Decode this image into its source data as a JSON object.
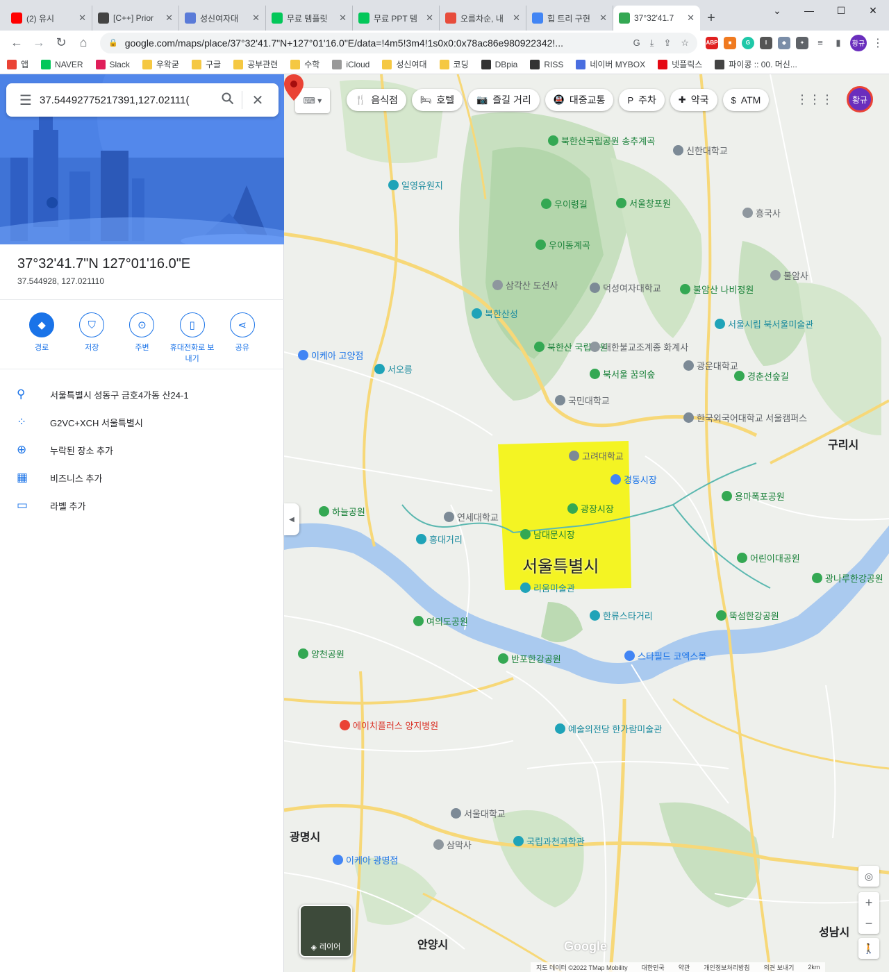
{
  "browser": {
    "tabs": [
      {
        "title": "(2) 유시",
        "color": "#ff0000",
        "icon": "youtube-icon"
      },
      {
        "title": "[C++] Prior",
        "color": "#444444",
        "icon": "tree-icon"
      },
      {
        "title": "성신여자대",
        "color": "#5a7bd8",
        "icon": "globe-icon"
      },
      {
        "title": "무료 템플릿",
        "color": "#03c75a",
        "icon": "naver-icon"
      },
      {
        "title": "무료 PPT 템",
        "color": "#03c75a",
        "icon": "blog-icon"
      },
      {
        "title": "오름차순, 내",
        "color": "#e74c3c",
        "icon": "z-icon"
      },
      {
        "title": "힙 트리 구현",
        "color": "#4285f4",
        "icon": "google-icon"
      },
      {
        "title": "37°32'41.7",
        "color": "#34a853",
        "icon": "maps-pin-icon"
      }
    ],
    "url": "google.com/maps/place/37°32'41.7\"N+127°01'16.0\"E/data=!4m5!3m4!1s0x0:0x78ac86e980922342!...",
    "bookmarks": [
      "앱",
      "NAVER",
      "Slack",
      "우왁굳",
      "구글",
      "공부관련",
      "수학",
      "iCloud",
      "성신여대",
      "코딩",
      "DBpia",
      "RISS",
      "네이버 MYBOX",
      "넷플릭스",
      "파이콩 :: 00. 머신..."
    ],
    "profile_initials": "황규"
  },
  "panel": {
    "search_value": "37.54492775217391,127.02111(",
    "title": "37°32'41.7\"N 127°01'16.0\"E",
    "decimal": "37.544928, 127.021110",
    "actions": [
      {
        "label": "경로",
        "icon": "directions-icon"
      },
      {
        "label": "저장",
        "icon": "bookmark-icon"
      },
      {
        "label": "주변",
        "icon": "nearby-icon"
      },
      {
        "label": "휴대전화로 보내기",
        "icon": "phone-icon"
      },
      {
        "label": "공유",
        "icon": "share-icon"
      }
    ],
    "info": [
      {
        "text": "서울특별시 성동구 금호4가동 산24-1",
        "icon": "location-pin-icon"
      },
      {
        "text": "G2VC+XCH 서울특별시",
        "icon": "plus-code-icon"
      },
      {
        "text": "누락된 장소 추가",
        "icon": "add-place-icon"
      },
      {
        "text": "비즈니스 추가",
        "icon": "add-business-icon"
      },
      {
        "text": "라벨 추가",
        "icon": "label-icon"
      }
    ]
  },
  "map": {
    "chips": [
      {
        "label": "음식점",
        "icon": "restaurant-icon"
      },
      {
        "label": "호텔",
        "icon": "hotel-icon"
      },
      {
        "label": "즐길 거리",
        "icon": "camera-icon"
      },
      {
        "label": "대중교통",
        "icon": "transit-icon"
      },
      {
        "label": "주차",
        "icon": "parking-icon"
      },
      {
        "label": "약국",
        "icon": "pharmacy-icon"
      },
      {
        "label": "ATM",
        "icon": "atm-icon"
      }
    ],
    "highlight_label": "서울특별시",
    "cities": [
      "구리시",
      "광명시",
      "안양시",
      "성남시"
    ],
    "pois": {
      "park": [
        "북한산국립공원 송추계곡",
        "우이령길",
        "서울창포원",
        "우이동계곡",
        "불암산 나비정원",
        "북한산 국립공원",
        "북서울 꿈의숲",
        "경춘선숲길",
        "용마폭포공원",
        "하늘공원",
        "여의도공원",
        "뚝섬한강공원",
        "광나루한강공원",
        "반포한강공원",
        "양천공원",
        "어린이대공원",
        "남대문시장",
        "광장시장"
      ],
      "attraction": [
        "일영유원지",
        "북한산성",
        "서오릉",
        "홍대거리",
        "한류스타거리",
        "서울시립 북서울미술관",
        "리움미술관",
        "국립과천과학관",
        "예술의전당 한가람미술관"
      ],
      "school": [
        "신한대학교",
        "덕성여자대학교",
        "광운대학교",
        "고려대학교",
        "연세대학교",
        "서울대학교",
        "한국외국어대학교 서울캠퍼스",
        "국민대학교"
      ],
      "temple": [
        "흥국사",
        "불암사",
        "삼각산 도선사",
        "대한불교조계종 화계사",
        "삼막사"
      ],
      "shop": [
        "이케아 고양점",
        "경동시장",
        "스타필드 코엑스몰",
        "이케아 광명점"
      ],
      "hospital": [
        "에이치플러스 양지병원"
      ]
    },
    "layers_label": "레이어",
    "attribution": [
      "지도 데이터 ©2022 TMap Mobility",
      "대한민국",
      "약관",
      "개인정보처리방침",
      "의견 보내기",
      "2km"
    ],
    "logo": "Google"
  }
}
